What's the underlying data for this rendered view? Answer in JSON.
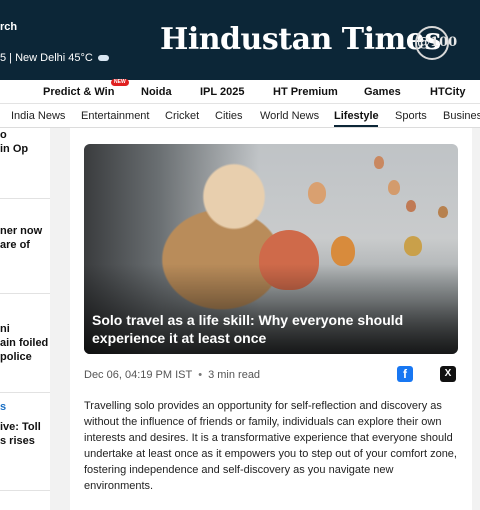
{
  "header": {
    "top_left_text": "rch",
    "location_text": "5 | New Delhi 45°C",
    "logo": "Hindustan Times",
    "anniversary_badge": "@100",
    "colors": {
      "background": "#0c2637",
      "text": "#ffffff"
    },
    "weather_icon": "cloud-icon"
  },
  "nav_primary": [
    {
      "label": "Predict & Win",
      "badge": "NEW"
    },
    {
      "label": "Noida"
    },
    {
      "label": "IPL 2025"
    },
    {
      "label": "HT Premium"
    },
    {
      "label": "Games"
    },
    {
      "label": "HTCity"
    }
  ],
  "nav_secondary": [
    {
      "label": "India News"
    },
    {
      "label": "Entertainment"
    },
    {
      "label": "Cricket"
    },
    {
      "label": "Cities"
    },
    {
      "label": "World News"
    },
    {
      "label": "Lifestyle",
      "active": true
    },
    {
      "label": "Sports"
    },
    {
      "label": "Busines"
    }
  ],
  "left_column": [
    [
      "o",
      "in Op"
    ],
    [
      "ner now",
      "are of"
    ],
    [
      "ni",
      "ain foiled",
      "police"
    ],
    [
      "s",
      "ive: Toll",
      "s rises"
    ]
  ],
  "article": {
    "title": "Solo travel as a life skill: Why everyone should experience it at least once",
    "date": "Dec 06, 04:19 PM IST",
    "read_time": "3 min read",
    "summary": "Travelling solo provides an opportunity for self-reflection and discovery as without the influence of friends or family, individuals can explore their own interests and desires. It is a transformative experience that everyone should undertake at least once as it empowers you to step out of your comfort zone, fostering independence and self-discovery as you navigate new environments.",
    "share_icons": [
      "facebook-icon",
      "x-icon"
    ],
    "image_subject": "woman smiling with hot air balloons"
  }
}
